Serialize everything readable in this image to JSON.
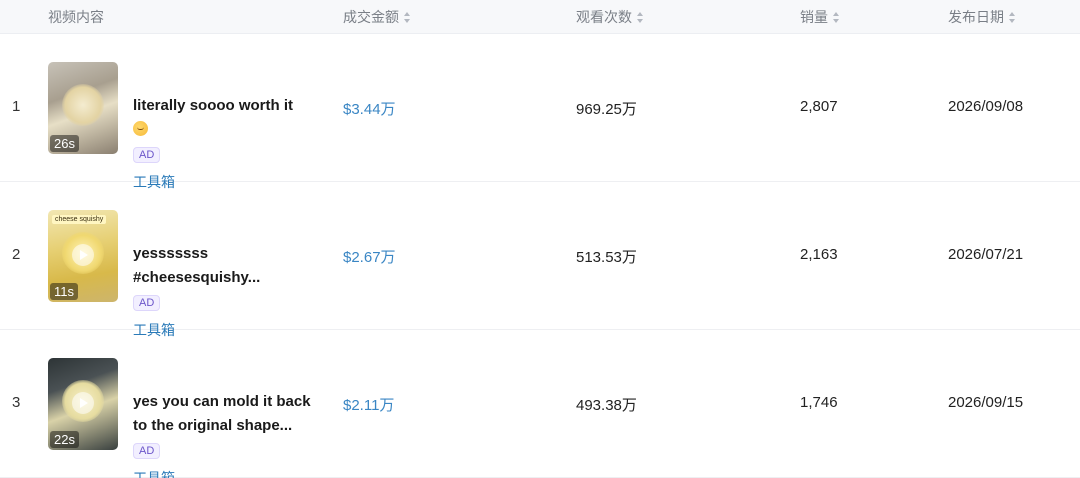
{
  "table": {
    "columns": [
      {
        "label": "视频内容",
        "sortable": false
      },
      {
        "label": "成交金额",
        "sortable": true
      },
      {
        "label": "观看次数",
        "sortable": true
      },
      {
        "label": "销量",
        "sortable": true
      },
      {
        "label": "发布日期",
        "sortable": true
      }
    ],
    "rows": [
      {
        "rank": "1",
        "title_line1": "literally soooo worth it",
        "emoji": "relieved-face-emoji",
        "badge": "AD",
        "tool_link": "工具箱",
        "duration": "26s",
        "amount": "$3.44万",
        "views": "969.25万",
        "sales": "2,807",
        "date": "2026/09/08"
      },
      {
        "rank": "2",
        "title_line1": "yesssssss",
        "title_line2": "#cheesesquishy...",
        "thumb_label": "cheese squishy",
        "badge": "AD",
        "tool_link": "工具箱",
        "duration": "11s",
        "amount": "$2.67万",
        "views": "513.53万",
        "sales": "2,163",
        "date": "2026/07/21"
      },
      {
        "rank": "3",
        "title_line1": "yes you can mold it back",
        "title_line2": "to the original shape...",
        "badge": "AD",
        "tool_link": "工具箱",
        "duration": "22s",
        "amount": "$2.11万",
        "views": "493.38万",
        "sales": "1,746",
        "date": "2026/09/15"
      }
    ]
  },
  "colors": {
    "amount": "#3a86c4",
    "tool_link": "#2a7ab8",
    "ad_badge": "#6b55c9",
    "header_bg": "#f7f8fa"
  }
}
